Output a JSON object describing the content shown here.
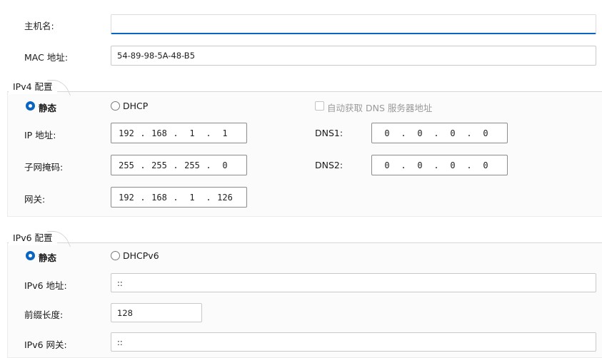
{
  "hostname": {
    "label": "主机名:",
    "value": ""
  },
  "mac": {
    "label": "MAC 地址:",
    "value": "54-89-98-5A-48-B5"
  },
  "ipv4": {
    "title": "IPv4 配置",
    "static_label": "静态",
    "dhcp_label": "DHCP",
    "auto_dns_label": "自动获取 DNS 服务器地址",
    "ip_label": "IP 地址:",
    "ip": [
      "192",
      "168",
      "1",
      "1"
    ],
    "mask_label": "子网掩码:",
    "mask": [
      "255",
      "255",
      "255",
      "0"
    ],
    "gateway_label": "网关:",
    "gateway": [
      "192",
      "168",
      "1",
      "126"
    ],
    "dns1_label": "DNS1:",
    "dns1": [
      "0",
      "0",
      "0",
      "0"
    ],
    "dns2_label": "DNS2:",
    "dns2": [
      "0",
      "0",
      "0",
      "0"
    ],
    "separator": "."
  },
  "ipv6": {
    "title": "IPv6 配置",
    "static_label": "静态",
    "dhcp_label": "DHCPv6",
    "address_label": "IPv6 地址:",
    "address": "::",
    "prefix_label": "前缀长度:",
    "prefix": "128",
    "gateway_label": "IPv6 网关:",
    "gateway": "::"
  },
  "colors": {
    "accent": "#0a64c2",
    "border": "#c9c9c9"
  }
}
